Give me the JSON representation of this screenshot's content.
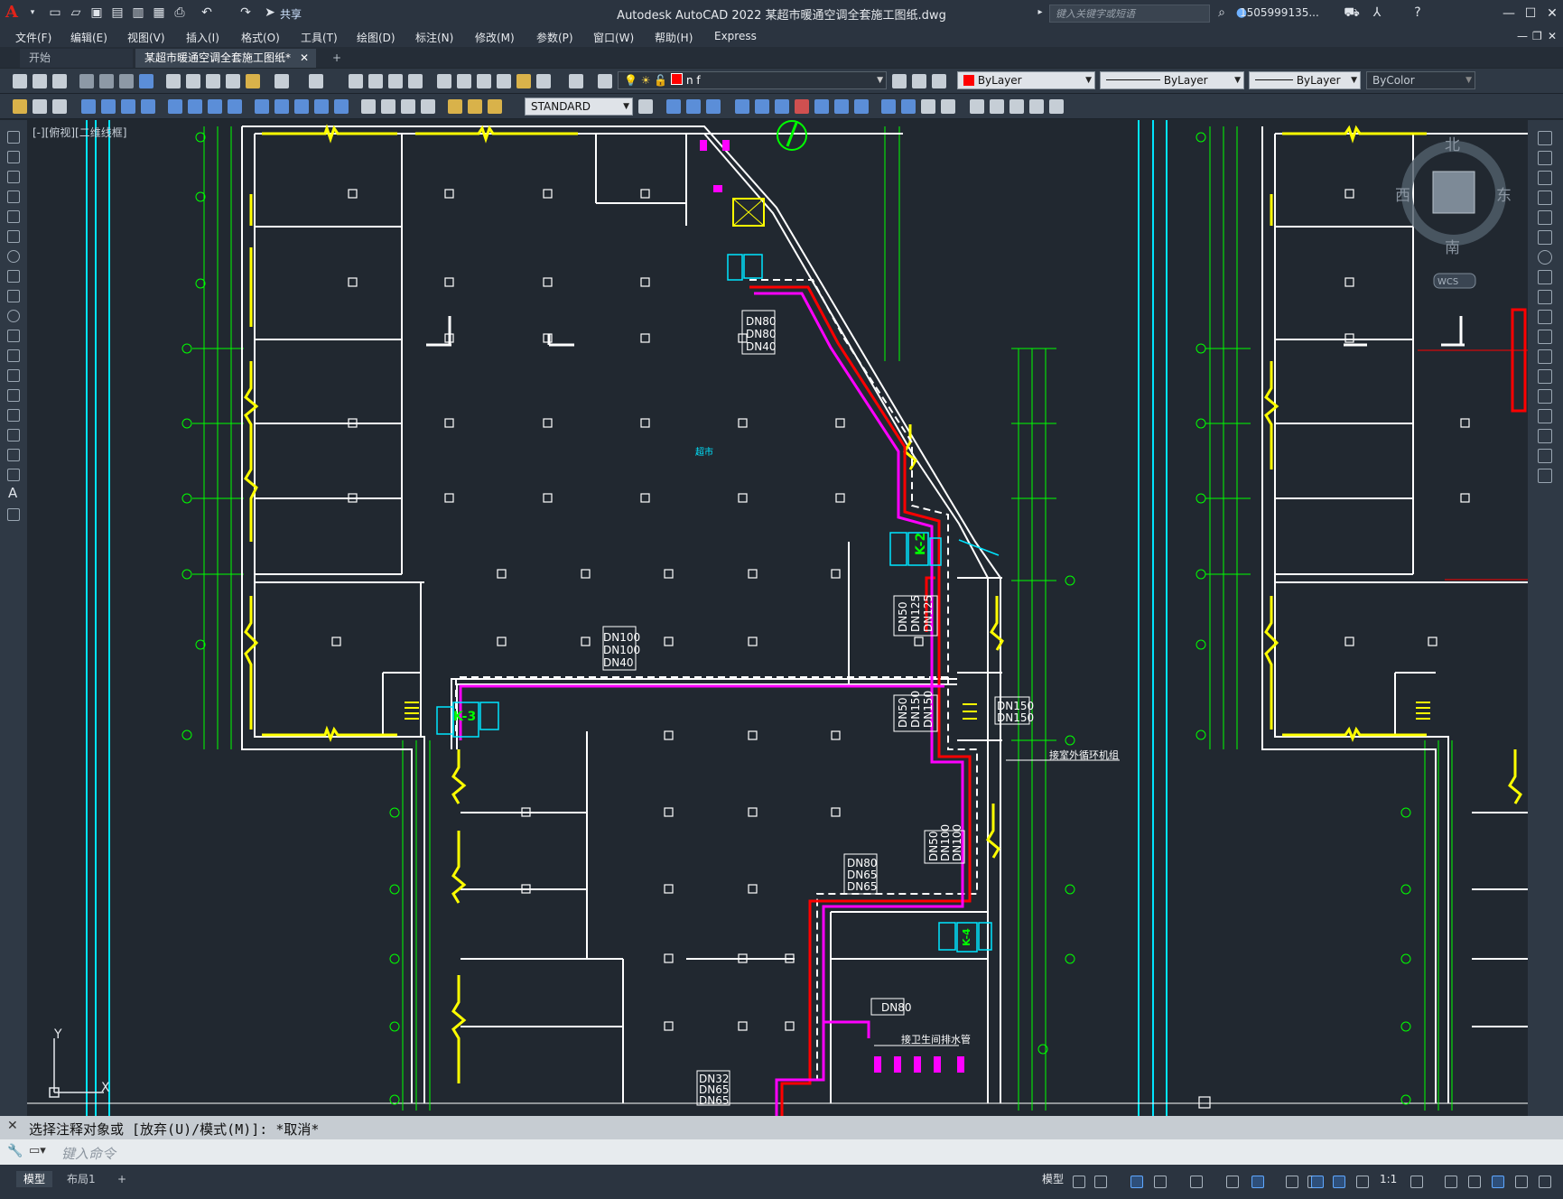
{
  "window": {
    "title": "Autodesk AutoCAD 2022    某超市暖通空调全套施工图纸.dwg",
    "share_label": "共享",
    "search_placeholder": "键入关键字或短语",
    "user_name": "1505999135...",
    "minimize": "—",
    "maximize": "☐",
    "close": "✕"
  },
  "menu": [
    "文件(F)",
    "编辑(E)",
    "视图(V)",
    "插入(I)",
    "格式(O)",
    "工具(T)",
    "绘图(D)",
    "标注(N)",
    "修改(M)",
    "参数(P)",
    "窗口(W)",
    "帮助(H)",
    "Express"
  ],
  "tabs": {
    "start": "开始",
    "active": "某超市暖通空调全套施工图纸*",
    "close_glyph": "✕",
    "add_glyph": "+"
  },
  "toolbar": {
    "layer_name": "n f",
    "color": "ByLayer",
    "linetype": "ByLayer",
    "lineweight": "ByLayer",
    "plotstyle": "ByColor",
    "text_style": "STANDARD"
  },
  "viewport": {
    "label": "[-][俯视][二维线框]",
    "viewcube": {
      "north": "北",
      "south": "南",
      "east": "东",
      "west": "西",
      "wcs": "WCS"
    },
    "ucs": {
      "y": "Y",
      "x": "X"
    }
  },
  "drawing_text": {
    "pipe_labels_1": [
      "DN80",
      "DN80",
      "DN40"
    ],
    "pipe_labels_2": [
      "DN100",
      "DN100",
      "DN40"
    ],
    "pipe_labels_3": [
      "DN50",
      "DN125",
      "DN125"
    ],
    "pipe_labels_4": [
      "DN50",
      "DN150",
      "DN150"
    ],
    "pipe_labels_5": [
      "DN150",
      "DN150"
    ],
    "pipe_labels_6": [
      "DN80",
      "DN65",
      "DN65"
    ],
    "pipe_labels_7": [
      "DN50",
      "DN100",
      "DN100"
    ],
    "pipe_labels_8": [
      "DN80"
    ],
    "pipe_labels_9": [
      "DN32",
      "DN65",
      "DN65"
    ],
    "unit_k2": "K-2",
    "unit_k3": "K-3",
    "unit_k4": "K-4",
    "note_outdoor": "接室外循环机组",
    "note_sanitary": "接卫生间排水管",
    "hall_label": "超市"
  },
  "command": {
    "history": "选择注释对象或 [放弃(U)/模式(M)]: *取消*",
    "placeholder": "键入命令"
  },
  "status": {
    "model_tab": "模型",
    "layout_tab": "布局1",
    "add_tab": "+",
    "model_button": "模型",
    "scale": "1:1"
  },
  "colors": {
    "background": "#212830",
    "wall": "#ffffff",
    "yellow": "#ffff00",
    "green": "#00ff00",
    "cyan": "#00e5ff",
    "magenta": "#ff00ff",
    "red": "#ff0000"
  }
}
